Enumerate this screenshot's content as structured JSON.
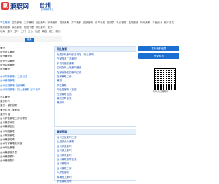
{
  "header": {
    "logo_icon": "兼",
    "logo_text": "兼职网",
    "logo_sub": "jianzhi.com",
    "city": "台州",
    "city_switch": "[切换城市]"
  },
  "nav": {
    "row1": [
      "学生兼职",
      "会员兼职",
      "工作兼职",
      "日结兼职",
      "家教兼职",
      "翻译兼职",
      "打字兼职",
      "促销兼职",
      "传单派发",
      "服务员",
      "礼仪模特",
      "话务客服",
      "网络兼职",
      "平面设计",
      "程序开发",
      "摄影摄像",
      "演出兼职",
      "校园代理",
      "其他兼职",
      "更多"
    ],
    "row2": [
      "临海",
      "温岭",
      "玉环",
      "三门",
      "天台",
      "仙居",
      "黄岩",
      "椒江",
      "路桥"
    ]
  },
  "search": {
    "button": "搜索"
  },
  "left": {
    "group1": [
      "兼职",
      "台州学生兼职",
      "台州兼职网",
      "台州日结兼职",
      "台州周末兼职",
      "台州兼职"
    ],
    "group2": [
      "台州周末兼职：工资日结",
      "台州暑假兼职",
      "台州正规兼职-在家兼职",
      "台州网络兼职：网上做兼职 足不出户"
    ],
    "group3": [
      "学生兼职",
      "兼职中介",
      "兼职 - 兼职招聘",
      "兼职平台 - 兼职网",
      "兼职介绍",
      "台州学生兼职工作有哪些",
      "台州兼职家教",
      "台州兼职日结",
      "台州网络兼职",
      "台州周末兼职",
      "台州兼职招聘",
      "台州打字兼职在家做",
      "台州网上兼职",
      "台州兼职服务员",
      "台州兼职模特",
      "台州兼职翻译"
    ]
  },
  "panel1": {
    "title": "网上兼职",
    "rows": [
      "免费手机兼职任务网站（线上兼职）",
      "在家做手工活兼职",
      "手机可做的兼职",
      "如何在网上找兼职赚钱",
      "在家就能做的兼职工作",
      "在家兼职工作",
      "兼职",
      "学生兼职",
      "网上做兼职（日结）",
      "在家兼职日结",
      "兼职招聘信息",
      "兼职网"
    ]
  },
  "panel2": {
    "title": "兼职招聘",
    "rows": [
      "台州日结兼职工作",
      "上班族业余兼职",
      "台州学生兼职",
      "台州晚上兼职",
      "台州周末兼职",
      "台州兼职招聘信息",
      "台州兼职网",
      "台州兼职工作",
      "大学生兼职",
      "寒暑假工兼职",
      "学生兼职招聘"
    ]
  },
  "right": {
    "buttons": [
      "发布兼职信息",
      "登录发布"
    ],
    "qr_caption": "扫码关注兼职网"
  },
  "colors": {
    "accent": "#1a6fd1",
    "link": "#2a5cb8",
    "brand": "#e03a3a"
  }
}
